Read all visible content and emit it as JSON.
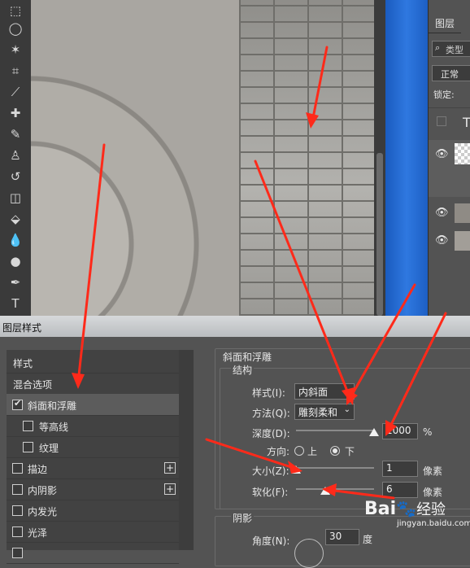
{
  "dialog_title": "图层样式",
  "layers_panel": {
    "tab": "图层",
    "search_placeholder": "类型",
    "blend_mode": "正常",
    "lock_label": "锁定:",
    "text_glyph": "T"
  },
  "style_list": {
    "header": "样式",
    "blend_options": "混合选项",
    "items": [
      {
        "label": "斜面和浮雕",
        "checked": true
      },
      {
        "label": "等高线",
        "checked": false
      },
      {
        "label": "纹理",
        "checked": false
      },
      {
        "label": "描边",
        "checked": false
      },
      {
        "label": "内阴影",
        "checked": false
      },
      {
        "label": "内发光",
        "checked": false
      },
      {
        "label": "光泽",
        "checked": false
      }
    ]
  },
  "bevel": {
    "section_title": "斜面和浮雕",
    "structure_title": "结构",
    "style_label": "样式(I):",
    "style_value": "内斜面",
    "technique_label": "方法(Q):",
    "technique_value": "雕刻柔和",
    "depth_label": "深度(D):",
    "depth_value": "1000",
    "depth_unit": "%",
    "direction_label": "方向:",
    "direction_up": "上",
    "direction_down": "下",
    "size_label": "大小(Z):",
    "size_value": "1",
    "size_unit": "像素",
    "soften_label": "软化(F):",
    "soften_value": "6",
    "soften_unit": "像素"
  },
  "shading": {
    "title": "阴影",
    "angle_label": "角度(N):",
    "angle_value": "30",
    "angle_unit": "度"
  },
  "watermark": {
    "brand": "Bai",
    "suffix": "经验",
    "url": "jingyan.baidu.com"
  },
  "colors": {
    "panel": "#535353",
    "annotation_arrow": "#ff2a1a",
    "desktop_blue": "#2f78e0"
  }
}
